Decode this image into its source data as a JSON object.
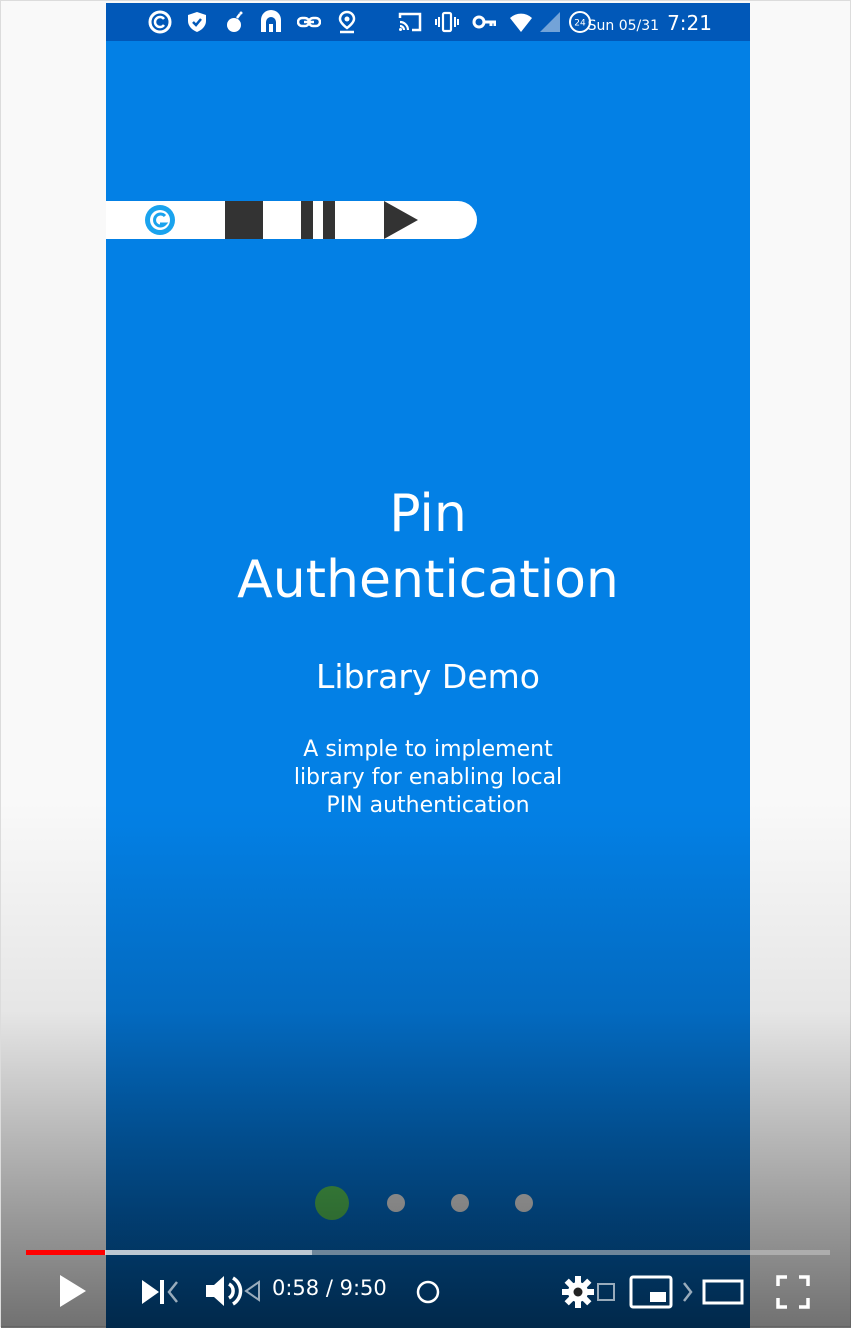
{
  "status_bar": {
    "date": "Sun 05/31",
    "time": "7:21",
    "clock_badge": "24",
    "icons": [
      "app-g-icon",
      "shield-check-icon",
      "bomb-icon",
      "tunnel-icon",
      "link-icon",
      "location-icon",
      "cast-icon",
      "vibrate-icon",
      "vpn-key-icon",
      "wifi-icon",
      "cell-signal-icon",
      "clock-24-icon"
    ]
  },
  "media_overlay": {
    "icons": [
      "app-g-icon",
      "stop-icon",
      "pause-icon",
      "play-icon"
    ]
  },
  "hero": {
    "title_line1": "Pin",
    "title_line2": "Authentication",
    "subtitle": "Library Demo",
    "description_line1": "A simple to implement",
    "description_line2": "library for enabling local",
    "description_line3": "PIN authentication"
  },
  "pager": {
    "page_count": 4,
    "active_index": 0,
    "active_color": "#4caf50",
    "inactive_color": "#d0d0d0"
  },
  "player": {
    "current_time": "0:58",
    "separator": " / ",
    "duration": "9:50",
    "played_fraction": 0.098,
    "buffered_fraction": 0.356,
    "accent_color": "#ff0000",
    "icons": [
      "play-icon",
      "next-icon",
      "volume-icon",
      "autoplay-toggle-icon",
      "settings-icon",
      "miniplayer-icon",
      "theater-mode-icon",
      "fullscreen-icon"
    ]
  },
  "colors": {
    "app_blue": "#0380e5",
    "status_bar_blue": "#0158b8"
  }
}
